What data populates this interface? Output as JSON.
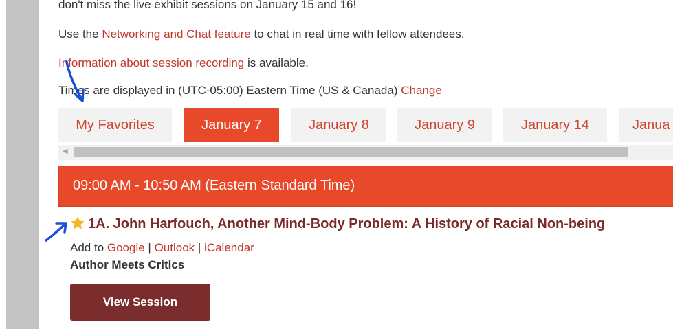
{
  "intro": {
    "line1": "don't miss the live exhibit sessions on January 15 and 16!",
    "line2_prefix": "Use the ",
    "line2_link": "Networking and Chat feature",
    "line2_suffix": " to chat in real time with fellow attendees.",
    "line3_link": "Information about session recording",
    "line3_suffix": " is available.",
    "line4_prefix": "Times are displayed in (UTC-05:00) Eastern Time (US & Canada) ",
    "line4_link": "Change"
  },
  "tabs": {
    "favorites": "My Favorites",
    "jan7": "January 7",
    "jan8": "January 8",
    "jan9": "January 9",
    "jan14": "January 14",
    "jan15": "Janua"
  },
  "active_tab": "January 7",
  "time_slot": "09:00 AM - 10:50 AM (Eastern Standard Time)",
  "session": {
    "title": "1A. John Harfouch, Another Mind-Body Problem: A History of Racial Non-being",
    "add_to_label": "Add to ",
    "google": "Google",
    "sep1": " | ",
    "outlook": "Outlook",
    "sep2": " | ",
    "icalendar": "iCalendar",
    "type": "Author Meets Critics",
    "view_button": "View Session"
  },
  "icons": {
    "favorite_star": "star-icon",
    "scroll_left": "scroll-left-arrow-icon",
    "annotation_arrows": "hand-drawn-arrow-icon"
  },
  "colors": {
    "accent": "#e8492a",
    "link": "#c0392b",
    "title": "#7a2a2a",
    "button": "#7b2d2d",
    "star": "#f5b820",
    "annotation": "#1b4fd6"
  }
}
